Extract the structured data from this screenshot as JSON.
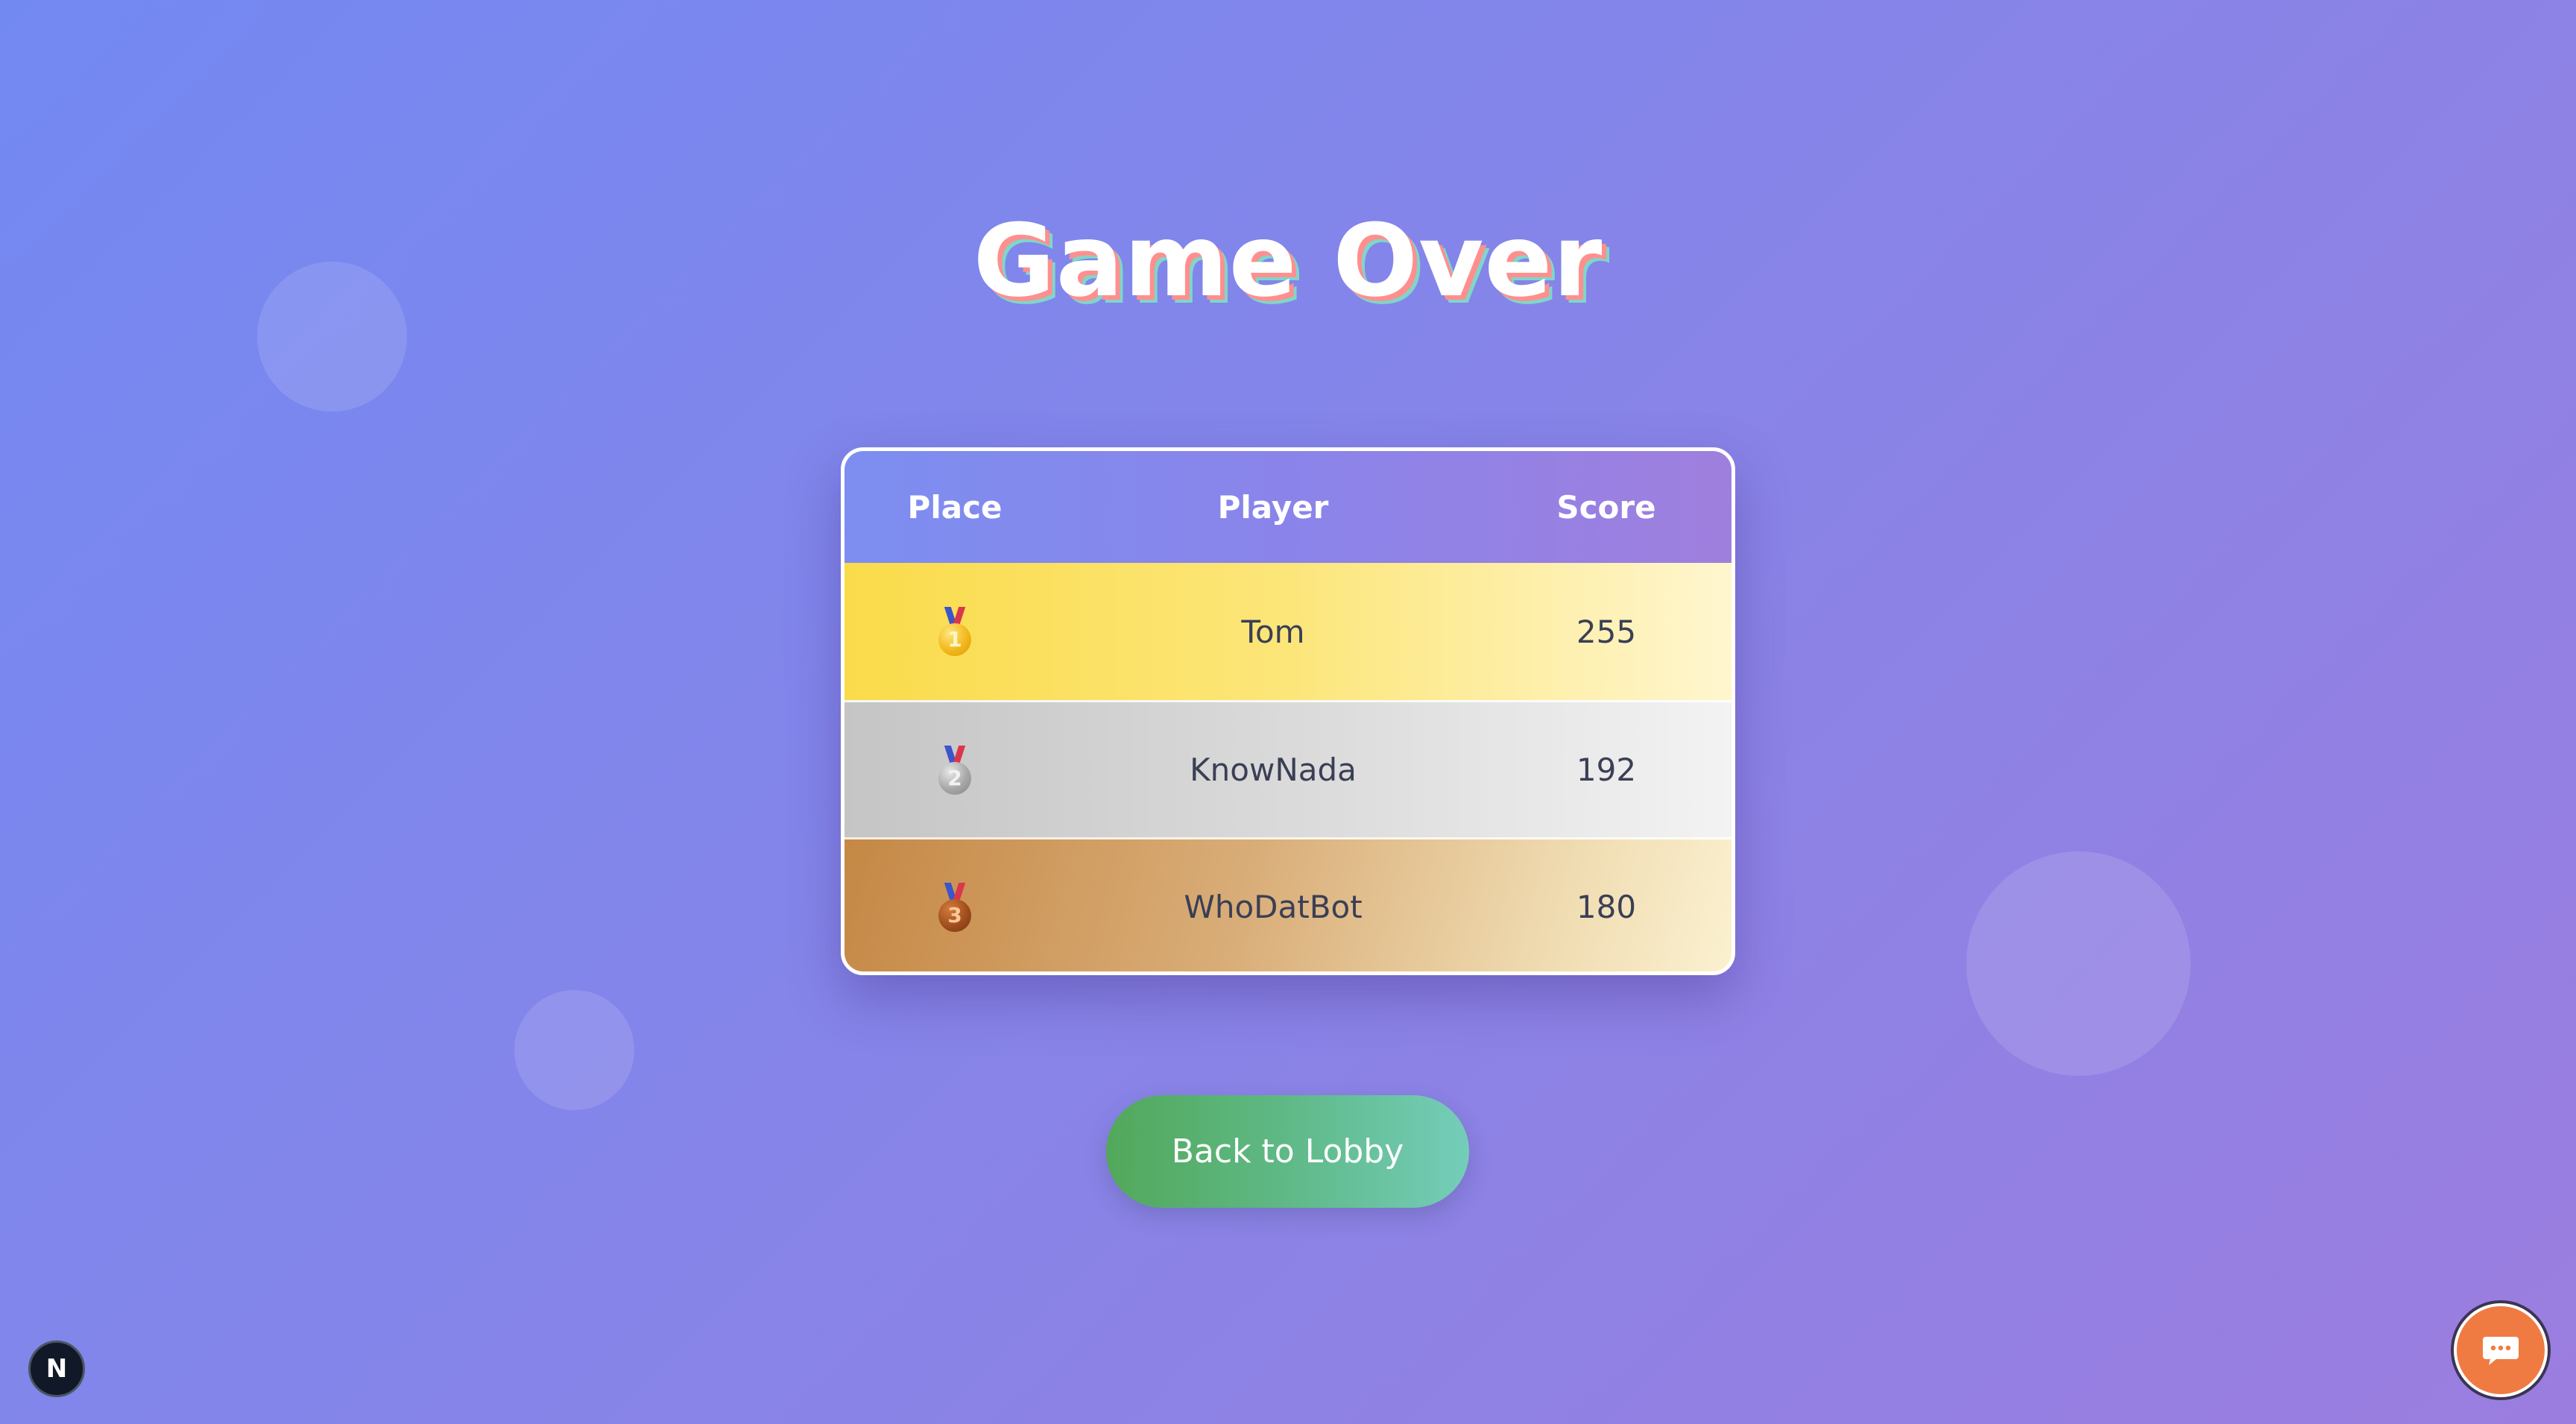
{
  "title": "Game Over",
  "leaderboard": {
    "headers": {
      "place": "Place",
      "player": "Player",
      "score": "Score"
    },
    "rows": [
      {
        "place": "1",
        "medal": "gold-medal-icon",
        "player": "Tom",
        "score": "255"
      },
      {
        "place": "2",
        "medal": "silver-medal-icon",
        "player": "KnowNada",
        "score": "192"
      },
      {
        "place": "3",
        "medal": "bronze-medal-icon",
        "player": "WhoDatBot",
        "score": "180"
      }
    ]
  },
  "actions": {
    "back_label": "Back to Lobby"
  },
  "dev_badge": {
    "letter": "N"
  },
  "chat": {
    "icon": "chat-bubble-icon"
  },
  "colors": {
    "background_start": "#7389f2",
    "background_end": "#9b7ddf",
    "gold_row": "#fadb4a",
    "silver_row": "#c5c5c5",
    "bronze_row": "#c58845",
    "lobby_button": "#52a85a",
    "chat_button": "#ef7b43"
  }
}
